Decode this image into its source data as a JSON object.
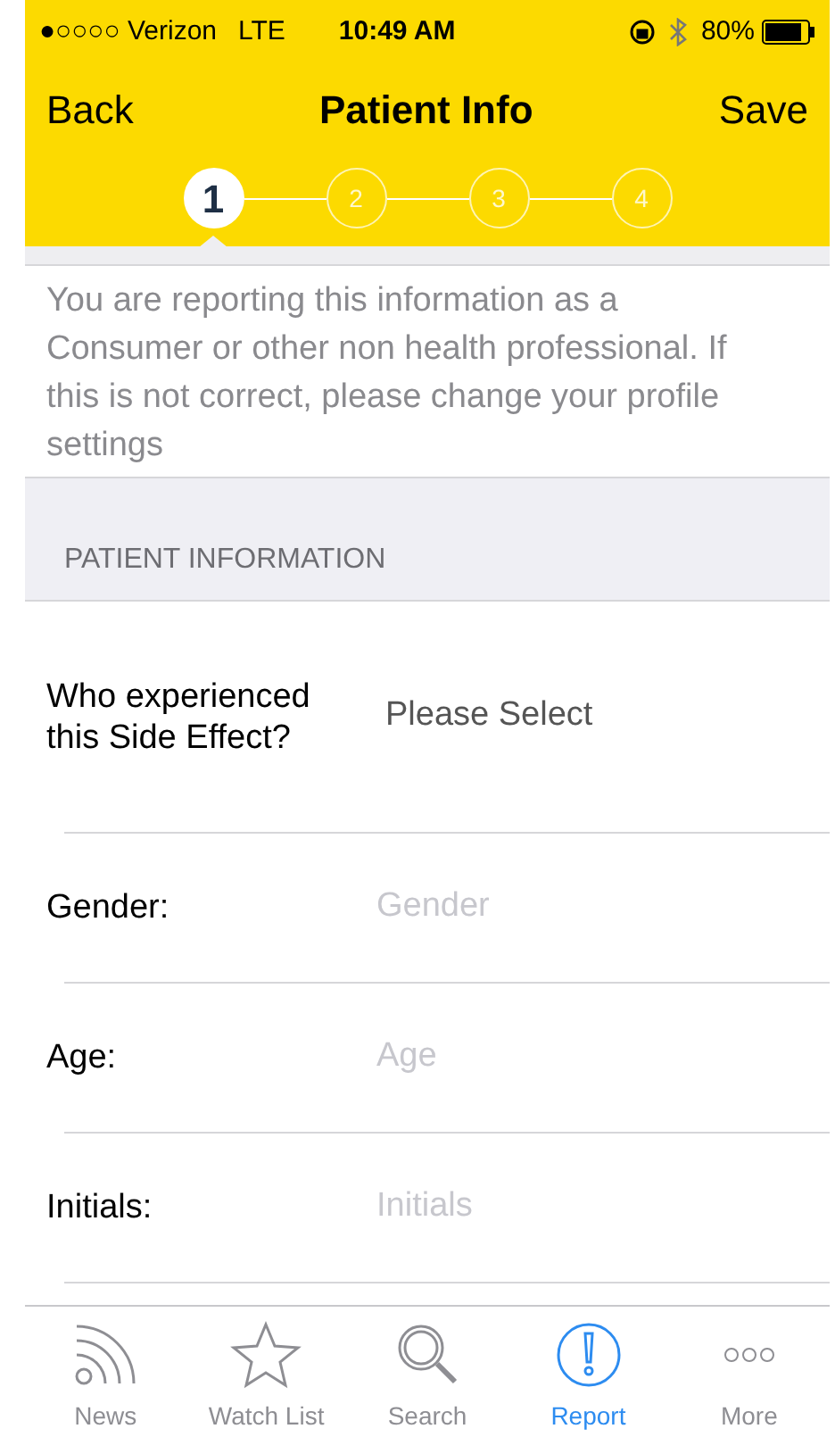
{
  "status_bar": {
    "signal": "●○○○○ Verizon",
    "network": "LTE",
    "time": "10:49 AM",
    "battery": "80%"
  },
  "nav": {
    "back": "Back",
    "title": "Patient Info",
    "save": "Save"
  },
  "steps": [
    {
      "label": "1",
      "selected": true
    },
    {
      "label": "2",
      "selected": false
    },
    {
      "label": "3",
      "selected": false
    },
    {
      "label": "4",
      "selected": false
    }
  ],
  "notice": "You are reporting this information as a Consumer or other non health professional. If this is not correct, please change your profile settings",
  "section_header": "PATIENT INFORMATION",
  "fields": [
    {
      "kind": "select",
      "label": "Who experienced this Side Effect?",
      "value": "Please Select"
    },
    {
      "kind": "input",
      "label": "Gender:",
      "placeholder": "Gender"
    },
    {
      "kind": "input",
      "label": "Age:",
      "placeholder": "Age"
    },
    {
      "kind": "input",
      "label": "Initials:",
      "placeholder": "Initials"
    }
  ],
  "tabs": [
    {
      "kind": "news",
      "label": "News",
      "selected": false
    },
    {
      "kind": "star",
      "label": "Watch List",
      "selected": false
    },
    {
      "kind": "search",
      "label": "Search",
      "selected": false
    },
    {
      "kind": "report",
      "label": "Report",
      "selected": true
    },
    {
      "kind": "more",
      "label": "More",
      "selected": false
    }
  ]
}
